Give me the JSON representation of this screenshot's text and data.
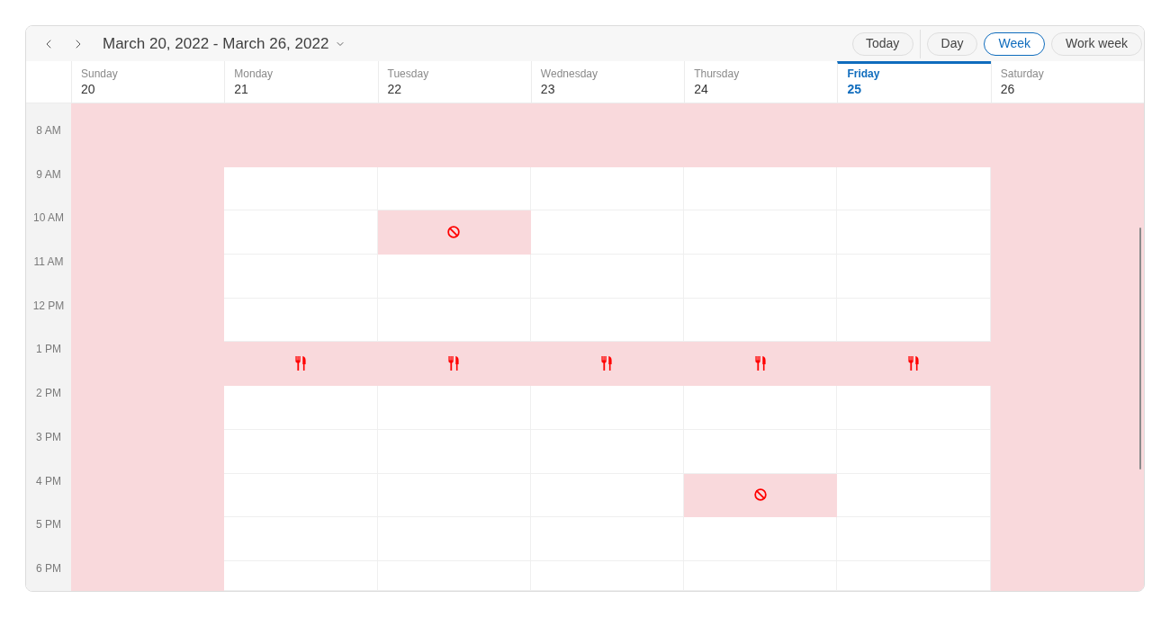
{
  "header": {
    "range": "March 20, 2022 - March 26, 2022",
    "today_button": "Today",
    "views": [
      {
        "label": "Day",
        "selected": false
      },
      {
        "label": "Week",
        "selected": true
      },
      {
        "label": "Work week",
        "selected": false
      }
    ]
  },
  "days": [
    {
      "weekday": "Sunday",
      "date": "20",
      "selected": false
    },
    {
      "weekday": "Monday",
      "date": "21",
      "selected": false
    },
    {
      "weekday": "Tuesday",
      "date": "22",
      "selected": false
    },
    {
      "weekday": "Wednesday",
      "date": "23",
      "selected": false
    },
    {
      "weekday": "Thursday",
      "date": "24",
      "selected": false
    },
    {
      "weekday": "Friday",
      "date": "25",
      "selected": true
    },
    {
      "weekday": "Saturday",
      "date": "26",
      "selected": false
    }
  ],
  "time_slots": [
    {
      "cells": [
        {
          "kind": "off"
        },
        {
          "kind": "off"
        },
        {
          "kind": "off"
        },
        {
          "kind": "off"
        },
        {
          "kind": "off"
        },
        {
          "kind": "off"
        },
        {
          "kind": "off"
        }
      ]
    },
    {
      "label": "8 AM",
      "cells": [
        {
          "kind": "off"
        },
        {
          "kind": "off"
        },
        {
          "kind": "off"
        },
        {
          "kind": "off"
        },
        {
          "kind": "off"
        },
        {
          "kind": "off"
        },
        {
          "kind": "off"
        }
      ]
    },
    {
      "label": "9 AM",
      "cells": [
        {
          "kind": "off"
        },
        {
          "kind": "free"
        },
        {
          "kind": "free"
        },
        {
          "kind": "free"
        },
        {
          "kind": "free"
        },
        {
          "kind": "free"
        },
        {
          "kind": "off"
        }
      ]
    },
    {
      "label": "10 AM",
      "cells": [
        {
          "kind": "off"
        },
        {
          "kind": "free"
        },
        {
          "kind": "blocked"
        },
        {
          "kind": "free"
        },
        {
          "kind": "free"
        },
        {
          "kind": "free"
        },
        {
          "kind": "off"
        }
      ]
    },
    {
      "label": "11 AM",
      "cells": [
        {
          "kind": "off"
        },
        {
          "kind": "free"
        },
        {
          "kind": "free"
        },
        {
          "kind": "free"
        },
        {
          "kind": "free"
        },
        {
          "kind": "free"
        },
        {
          "kind": "off"
        }
      ]
    },
    {
      "label": "12 PM",
      "cells": [
        {
          "kind": "off"
        },
        {
          "kind": "free"
        },
        {
          "kind": "free"
        },
        {
          "kind": "free"
        },
        {
          "kind": "free"
        },
        {
          "kind": "free"
        },
        {
          "kind": "off"
        }
      ]
    },
    {
      "label": "1 PM",
      "cells": [
        {
          "kind": "off"
        },
        {
          "kind": "lunch"
        },
        {
          "kind": "lunch"
        },
        {
          "kind": "lunch"
        },
        {
          "kind": "lunch"
        },
        {
          "kind": "lunch"
        },
        {
          "kind": "off"
        }
      ]
    },
    {
      "label": "2 PM",
      "cells": [
        {
          "kind": "off"
        },
        {
          "kind": "free"
        },
        {
          "kind": "free"
        },
        {
          "kind": "free"
        },
        {
          "kind": "free"
        },
        {
          "kind": "free"
        },
        {
          "kind": "off"
        }
      ]
    },
    {
      "label": "3 PM",
      "cells": [
        {
          "kind": "off"
        },
        {
          "kind": "free"
        },
        {
          "kind": "free"
        },
        {
          "kind": "free"
        },
        {
          "kind": "free"
        },
        {
          "kind": "free"
        },
        {
          "kind": "off"
        }
      ]
    },
    {
      "label": "4 PM",
      "cells": [
        {
          "kind": "off"
        },
        {
          "kind": "free"
        },
        {
          "kind": "free"
        },
        {
          "kind": "free"
        },
        {
          "kind": "blocked"
        },
        {
          "kind": "free"
        },
        {
          "kind": "off"
        }
      ]
    },
    {
      "label": "5 PM",
      "cells": [
        {
          "kind": "off"
        },
        {
          "kind": "free"
        },
        {
          "kind": "free"
        },
        {
          "kind": "free"
        },
        {
          "kind": "free"
        },
        {
          "kind": "free"
        },
        {
          "kind": "off"
        }
      ]
    },
    {
      "label": "6 PM",
      "cells": [
        {
          "kind": "off"
        },
        {
          "kind": "free"
        },
        {
          "kind": "free"
        },
        {
          "kind": "free"
        },
        {
          "kind": "free"
        },
        {
          "kind": "free"
        },
        {
          "kind": "off"
        }
      ]
    }
  ]
}
